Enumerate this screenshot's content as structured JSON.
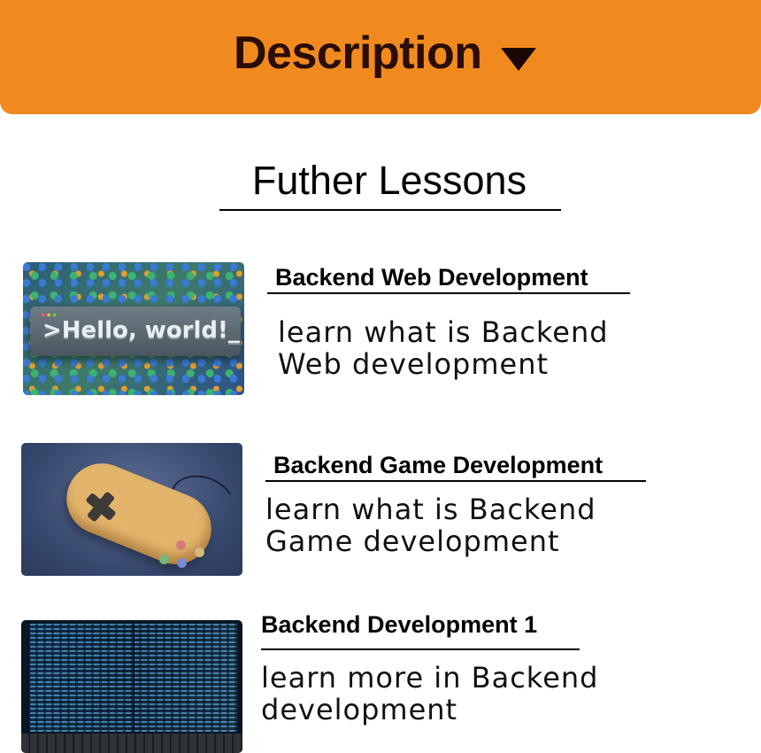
{
  "header": {
    "title": "Description",
    "caret_icon": "caret-down-icon",
    "background": "#f08a1f",
    "text_color": "#2a0d05"
  },
  "section": {
    "title": "Futher Lessons"
  },
  "lessons": [
    {
      "title": "Backend Web Development",
      "desc_lines": [
        "learn what is Backend",
        "Web development"
      ],
      "thumb_text": ">Hello, world!_"
    },
    {
      "title": "Backend Game Development",
      "desc_lines": [
        "learn what is Backend",
        "Game development"
      ]
    },
    {
      "title": "Backend Development 1",
      "desc_lines": [
        "learn more in Backend",
        "development"
      ]
    }
  ]
}
